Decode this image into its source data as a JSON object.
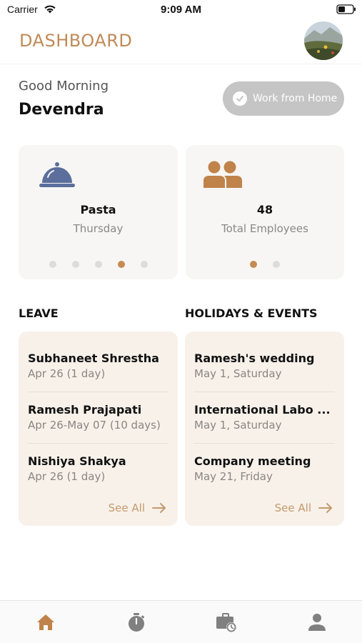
{
  "status_bar": {
    "carrier": "Carrier",
    "time": "9:09 AM",
    "icons": [
      "wifi-icon",
      "battery-icon"
    ]
  },
  "header": {
    "title": "DASHBOARD",
    "avatar": "profile-avatar"
  },
  "greeting": {
    "salutation": "Good Morning",
    "name": "Devendra"
  },
  "work_from_home": {
    "label": "Work from Home",
    "icon": "check-circle-icon",
    "state": "disabled"
  },
  "meal_card": {
    "icon": "food-cloche-icon",
    "title": "Pasta",
    "subtitle": "Thursday",
    "page_count": 5,
    "active_page": 4
  },
  "employees_card": {
    "icon": "people-icon",
    "title": "48",
    "subtitle": "Total Employees",
    "page_count": 2,
    "active_page": 1
  },
  "leave": {
    "heading": "LEAVE",
    "items": [
      {
        "name": "Subhaneet Shrestha",
        "date": "Apr 26 (1 day)"
      },
      {
        "name": "Ramesh Prajapati",
        "date": "Apr 26-May 07 (10 days)"
      },
      {
        "name": "Nishiya Shakya",
        "date": "Apr 26 (1 day)"
      }
    ],
    "see_all": "See All"
  },
  "events": {
    "heading": "HOLIDAYS & EVENTS",
    "items": [
      {
        "name": "Ramesh's wedding",
        "date": "May 1, Saturday"
      },
      {
        "name": "International Labo ...",
        "date": "May 1, Saturday"
      },
      {
        "name": "Company meeting",
        "date": "May 21, Friday"
      }
    ],
    "see_all": "See All"
  },
  "tab_bar": {
    "tabs": [
      "home-icon",
      "timer-icon",
      "briefcase-clock-icon",
      "person-icon"
    ],
    "active": "home-icon"
  },
  "colors": {
    "accent": "#bf8a56",
    "card_bg": "#f7f1ea",
    "muted_card": "#f8f6f4",
    "wfh_button": "#c5c5c5",
    "tab_active": "#c0834a",
    "tab_inactive": "#808080",
    "meal_icon": "#5b6e9c"
  }
}
